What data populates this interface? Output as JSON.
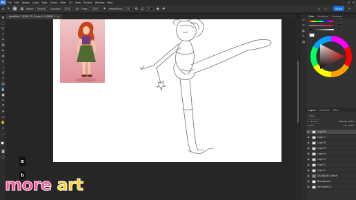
{
  "app": {
    "logo": "Ps"
  },
  "menu": [
    "File",
    "Edit",
    "Image",
    "Layer",
    "Type",
    "Select",
    "Filter",
    "3D",
    "View",
    "Plugins",
    "Window",
    "Help"
  ],
  "window_controls": {
    "minimize": "–",
    "maximize": "□",
    "close": "✕"
  },
  "options": {
    "mode_label": "Mode:",
    "mode_value": "Normal",
    "opacity_label": "Opacity:",
    "opacity_value": "100%",
    "flow_label": "Flow:",
    "flow_value": "100%",
    "smoothing_label": "Smoothing:",
    "smoothing_value": "7%",
    "angle_value": "0°"
  },
  "share_label": "Share",
  "document": {
    "tab_title": "JeadWick 1 @ 66.7% (Layer 4, RGB/8) *",
    "close": "×"
  },
  "color_panel": {
    "tabs": [
      "Color",
      "Swatches",
      "Gradients",
      "Patterns"
    ],
    "h_value": "",
    "s_value": "",
    "b_value": ""
  },
  "layers_panel": {
    "tabs": [
      "Layers",
      "Channels",
      "Paths"
    ],
    "kind_label": "Kind",
    "blend_mode": "Normal",
    "opacity_label": "Opacity:",
    "opacity_value": "100%",
    "lock_label": "Lock:",
    "fill_label": "Fill:",
    "fill_value": "100%",
    "layers": [
      {
        "name": "Layer 8",
        "selected": true,
        "thumb": "transparent"
      },
      {
        "name": "Layer 7",
        "selected": false,
        "thumb": "transparent"
      },
      {
        "name": "Layer 6",
        "selected": false,
        "thumb": "transparent"
      },
      {
        "name": "Layer 5",
        "selected": false,
        "thumb": "transparent"
      },
      {
        "name": "Layer 4",
        "selected": false,
        "thumb": "transparent"
      },
      {
        "name": "Layer 3",
        "selected": false,
        "thumb": "transparent"
      },
      {
        "name": "Layer 2",
        "selected": false,
        "thumb": "transparent"
      },
      {
        "name": "Layer 1",
        "selected": false,
        "thumb": "transparent"
      },
      {
        "name": "DSCN8263 Sketch",
        "selected": false,
        "thumb": "group"
      },
      {
        "name": "Background",
        "selected": false,
        "thumb": "white"
      },
      {
        "name": "Ink Sprite LE",
        "selected": false,
        "thumb": "transparent"
      }
    ]
  },
  "overlay": {
    "key_e": "e",
    "key_b": "b",
    "brand_word1": "more",
    "brand_word2": "art"
  },
  "colors": {
    "accent": "#1473e6",
    "canvas": "#ffffff",
    "workspace": "#262626",
    "panel": "#323232"
  },
  "icons": [
    "move-icon",
    "marquee-icon",
    "lasso-icon",
    "brush-icon",
    "eraser-icon",
    "zoom-icon",
    "eye-icon",
    "search-icon"
  ]
}
